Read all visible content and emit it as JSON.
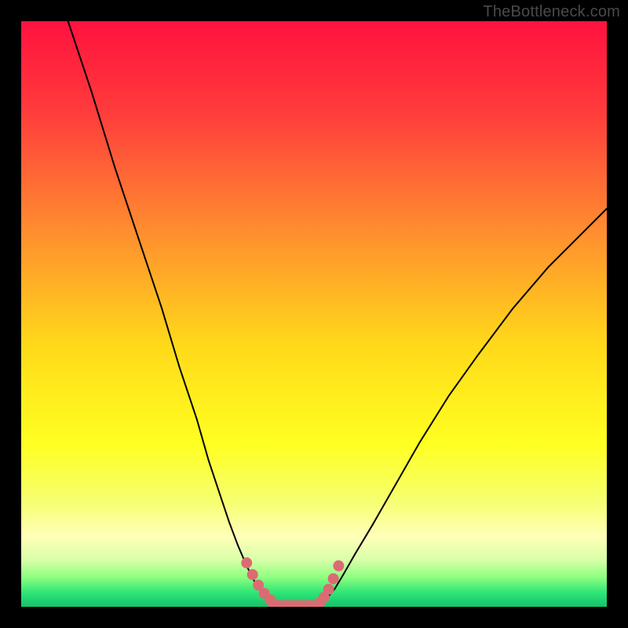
{
  "watermark": "TheBottleneck.com",
  "colors": {
    "frame": "#000000",
    "gradient_stops": [
      {
        "offset": 0.0,
        "color": "#ff123e"
      },
      {
        "offset": 0.15,
        "color": "#ff3a3c"
      },
      {
        "offset": 0.35,
        "color": "#ff8a30"
      },
      {
        "offset": 0.55,
        "color": "#ffd81a"
      },
      {
        "offset": 0.72,
        "color": "#ffff20"
      },
      {
        "offset": 0.82,
        "color": "#f6ff70"
      },
      {
        "offset": 0.88,
        "color": "#ffffb8"
      },
      {
        "offset": 0.92,
        "color": "#d8ffa8"
      },
      {
        "offset": 0.95,
        "color": "#8cff80"
      },
      {
        "offset": 0.975,
        "color": "#30e676"
      },
      {
        "offset": 1.0,
        "color": "#14c26a"
      }
    ],
    "curve": "#000000",
    "marker": "#db6b73"
  },
  "chart_data": {
    "type": "line",
    "title": "",
    "xlabel": "",
    "ylabel": "",
    "xlim": [
      0,
      100
    ],
    "ylim": [
      0,
      100
    ],
    "grid": false,
    "legend": false,
    "series": [
      {
        "name": "left-curve",
        "x": [
          8,
          12,
          16,
          20,
          24,
          27,
          30,
          32,
          34,
          35.5,
          37,
          38.5,
          40,
          41,
          42,
          43
        ],
        "y": [
          100,
          88,
          75,
          63,
          51,
          41,
          32,
          25,
          19,
          14.5,
          10.5,
          7,
          4,
          2.5,
          1.2,
          0.3
        ]
      },
      {
        "name": "right-curve",
        "x": [
          51,
          52,
          53.5,
          55,
          57,
          60,
          64,
          68,
          73,
          78,
          84,
          90,
          96,
          100
        ],
        "y": [
          0.3,
          1.3,
          3.0,
          5.5,
          9,
          14,
          21,
          28,
          36,
          43,
          51,
          58,
          64,
          68
        ]
      },
      {
        "name": "left-markers",
        "x": [
          38.5,
          39.5,
          40.5,
          41.5,
          42.5,
          43,
          43.5
        ],
        "y": [
          7.5,
          5.5,
          3.7,
          2.3,
          1.2,
          0.6,
          0.25
        ]
      },
      {
        "name": "right-markers",
        "x": [
          50.5,
          51,
          51.7,
          52.5,
          53.3,
          54.2
        ],
        "y": [
          0.25,
          0.7,
          1.6,
          3.0,
          4.8,
          7.0
        ]
      },
      {
        "name": "bottom-bar",
        "x": [
          43.5,
          45,
          46,
          47,
          48,
          49,
          50,
          50.5
        ],
        "y": [
          0.25,
          0.25,
          0.25,
          0.25,
          0.25,
          0.25,
          0.25,
          0.25
        ]
      }
    ]
  }
}
